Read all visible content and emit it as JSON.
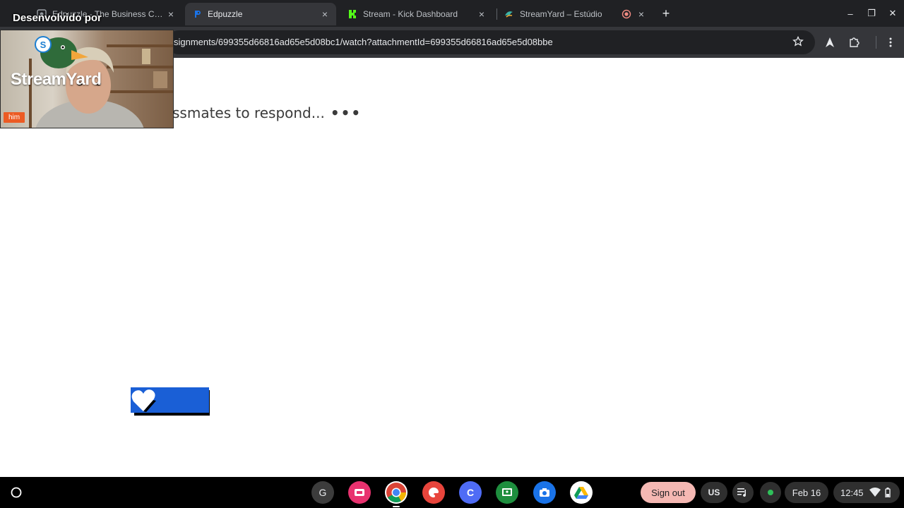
{
  "tabs": [
    {
      "title": "Edpuzzle - The Business Cycle",
      "active": false,
      "icon": "edpuzzle-icon"
    },
    {
      "title": "Edpuzzle",
      "active": true,
      "icon": "edpuzzle-icon"
    },
    {
      "title": "Stream - Kick Dashboard",
      "active": false,
      "icon": "kick-icon"
    },
    {
      "title": "StreamYard – Estúdio",
      "active": false,
      "icon": "streamyard-icon",
      "recording": true
    }
  ],
  "tab_close_glyph": "×",
  "new_tab_glyph": "+",
  "window_controls": {
    "minimize": "–",
    "restore": "❐",
    "close": "✕"
  },
  "address_bar": {
    "url": "signments/699355d66816ad65e5d08bc1/watch?attachmentId=699355d66816ad65e5d08bbe"
  },
  "page": {
    "waiting_text": "ssmates to respond...",
    "dots": "•••"
  },
  "overlay": {
    "title": "Desenvolvido por",
    "brand": "StreamYard",
    "name_tag": "him"
  },
  "shelf": {
    "apps": [
      "G",
      "",
      "",
      "",
      "C",
      "",
      "",
      ""
    ],
    "sign_out": "Sign out",
    "keyboard": "US",
    "date": "Feb 16",
    "time": "12:45"
  },
  "colors": {
    "tabbar": "#202124",
    "toolbar": "#35363a",
    "omnibox": "#202124",
    "heart_button": "#1a5fd6",
    "kick_green": "#53fc18",
    "sign_out_pill": "#f5b8b3",
    "name_tag": "#ec5b24",
    "status_dot": "#2fc05a"
  }
}
